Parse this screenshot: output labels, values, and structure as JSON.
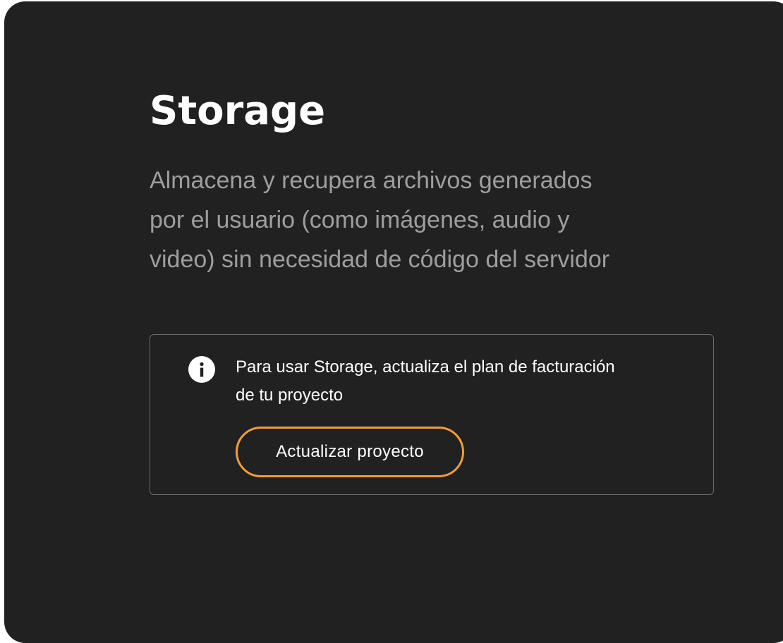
{
  "title": "Storage",
  "description_lines": [
    "Almacena y recupera archivos generados",
    "por el usuario (como imágenes, audio y",
    "video) sin necesidad de código del servidor"
  ],
  "notice": {
    "icon": "info-icon",
    "text_lines": [
      "Para usar Storage, actualiza el plan de facturación",
      "de tu proyecto"
    ],
    "button_label": "Actualizar proyecto"
  },
  "colors": {
    "panel_background": "#212121",
    "title": "#ffffff",
    "description": "#9e9e9e",
    "notice_border": "#6b6b6b",
    "button_border": "#f29b38"
  }
}
